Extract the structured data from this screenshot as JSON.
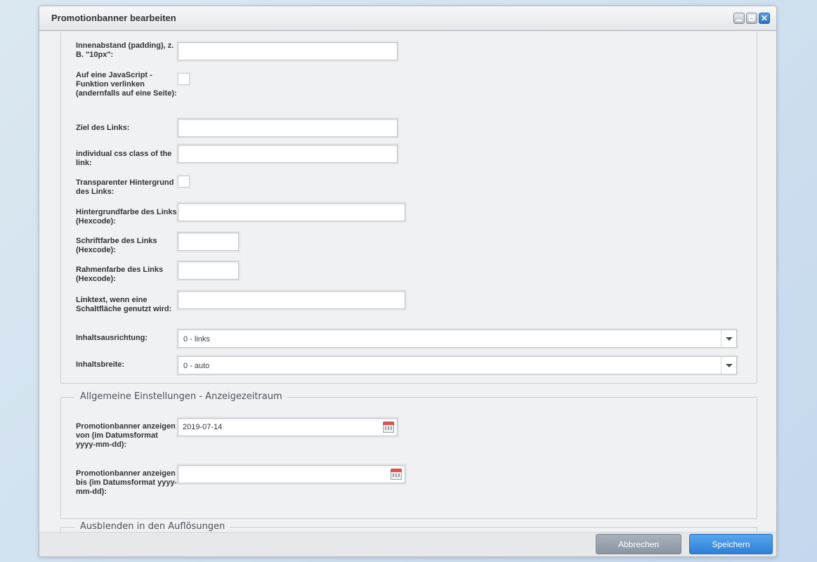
{
  "window": {
    "title": "Promotionbanner bearbeiten"
  },
  "section_link": {
    "padding_label": "Innenabstand (padding), z. B. \"10px\":",
    "padding_value": "",
    "js_link_label": "Auf eine JavaScript - Funktion verlinken (andernfalls auf eine Seite):",
    "link_target_label": "Ziel des Links:",
    "link_target_value": "",
    "css_class_label": "individual css class of the link:",
    "css_class_value": "",
    "transparent_bg_label": "Transparenter Hintergrund des Links:",
    "bg_color_label": "Hintergrundfarbe des Links (Hexcode):",
    "bg_color_value": "",
    "font_color_label": "Schriftfarbe des Links (Hexcode):",
    "font_color_value": "",
    "border_color_label": "Rahmenfarbe des Links (Hexcode):",
    "border_color_value": "",
    "button_text_label": "Linktext, wenn eine Schaltfläche genutzt wird:",
    "button_text_value": "",
    "alignment_label": "Inhaltsausrichtung:",
    "alignment_value": "0 - links",
    "width_label": "Inhaltsbreite:",
    "width_value": "0 - auto"
  },
  "section_period": {
    "legend": "Allgemeine Einstellungen - Anzeigezeitraum",
    "from_label": "Promotionbanner anzeigen von (im Datumsformat yyyy-mm-dd):",
    "from_value": "2019-07-14",
    "to_label": "Promotionbanner anzeigen bis (im Datumsformat yyyy-mm-dd):",
    "to_value": ""
  },
  "section_hide": {
    "legend": "Ausblenden in den Auflösungen"
  },
  "footer": {
    "cancel_label": "Abbrechen",
    "save_label": "Speichern"
  },
  "colors": {
    "primary_button": "#3a8ae0",
    "secondary_button": "#959fab",
    "close_button": "#3b83d6"
  },
  "icons": [
    "minimize-icon",
    "maximize-icon",
    "close-icon",
    "calendar-icon",
    "chevron-down-icon"
  ]
}
